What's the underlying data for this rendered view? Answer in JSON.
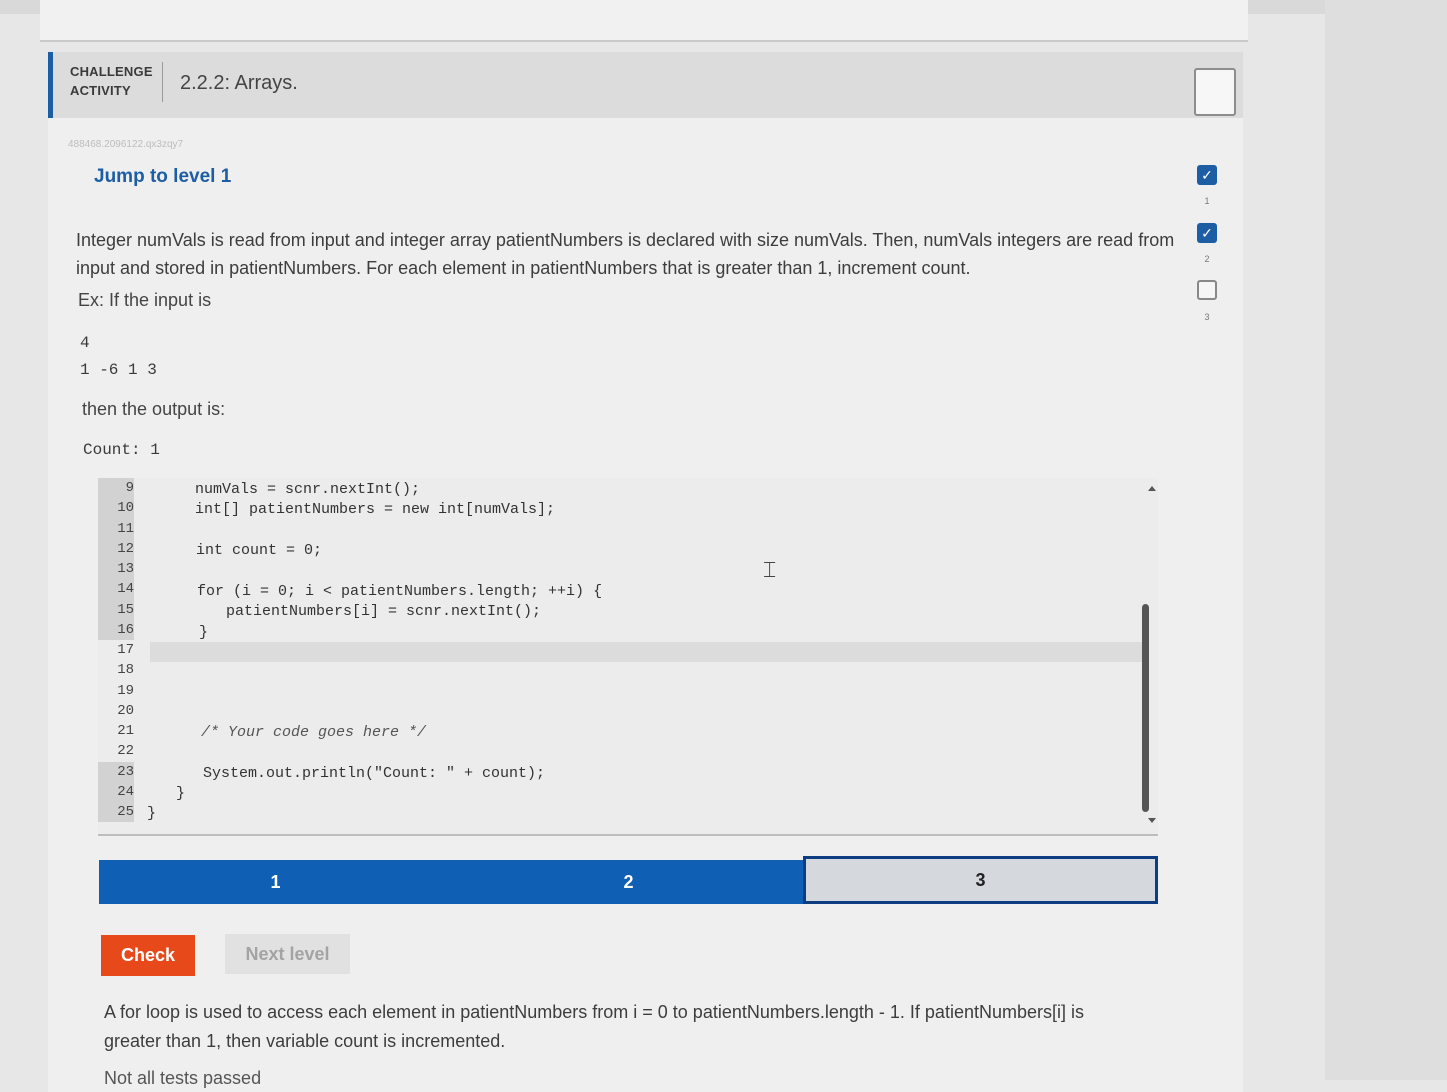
{
  "header": {
    "challenge_line1": "CHALLENGE",
    "challenge_line2": "ACTIVITY",
    "title": "2.2.2: Arrays."
  },
  "activity_id": "488468.2096122.qx3zqy7",
  "jump_link": "Jump to level 1",
  "instructions": "Integer numVals is read from input and integer array patientNumbers is declared with size numVals. Then, numVals integers are read from input and stored in patientNumbers. For each element in patientNumbers that is greater than 1, increment count.",
  "example": {
    "intro": "Ex: If the input is",
    "input_line1": "4",
    "input_line2": "1 -6 1 3",
    "then": "then the output is:",
    "output": "Count: 1"
  },
  "editor": {
    "line_numbers": [
      "9",
      "10",
      "11",
      "12",
      "13",
      "14",
      "15",
      "16",
      "17",
      "18",
      "19",
      "20",
      "21",
      "22",
      "23",
      "24",
      "25"
    ],
    "code": {
      "l9": "numVals = scnr.nextInt();",
      "l10": "int[] patientNumbers = new int[numVals];",
      "l12": "int count = 0;",
      "l14": "for (i = 0; i < patientNumbers.length; ++i) {",
      "l15": "patientNumbers[i] = scnr.nextInt();",
      "l16": "}",
      "l21": "/* Your code goes here */",
      "l23": "System.out.println(\"Count: \" + count);",
      "l24": "}",
      "l25": "}"
    }
  },
  "progress": {
    "segments": [
      "1",
      "2",
      "3"
    ],
    "completed": 2,
    "current": 3
  },
  "buttons": {
    "check": "Check",
    "next_level": "Next level"
  },
  "explanation": "A for loop is used to access each element in patientNumbers from i = 0 to patientNumbers.length - 1. If patientNumbers[i] is greater than 1, then variable count is incremented.",
  "status": "Not all tests passed",
  "level_nav": {
    "levels": [
      "1",
      "2",
      "3"
    ],
    "completed": [
      true,
      true,
      false
    ]
  },
  "colors": {
    "brand_blue": "#1d5da4",
    "progress_blue": "#0f5fb5",
    "check_orange": "#e8491a"
  }
}
